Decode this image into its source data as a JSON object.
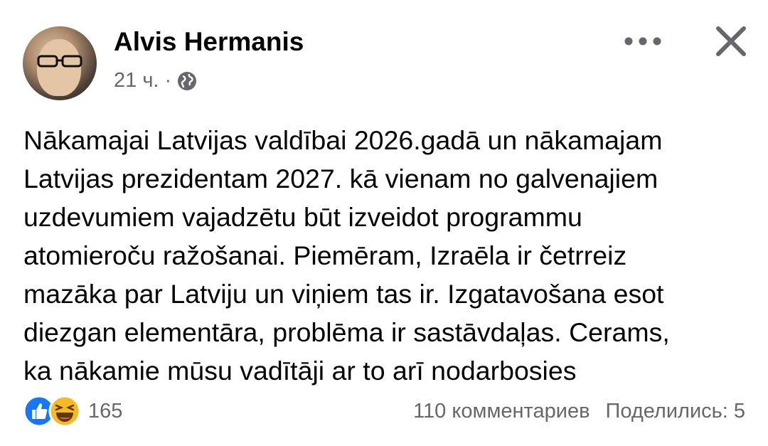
{
  "post": {
    "author": "Alvis Hermanis",
    "time": "21 ч.",
    "separator": "·",
    "visibility_icon": "globe-icon",
    "text_lines": [
      "Nākamajai Latvijas valdībai 2026.gadā un nākamajam",
      "Latvijas prezidentam 2027. kā vienam no galvenajiem",
      "uzdevumiem vajadzētu būt izveidot programmu",
      "atomieroču ražošanai. Piemēram, Izraēla ir četrreiz",
      "mazāka par Latviju un viņiem tas ir. Izgatavošana esot",
      "diezgan elementāra, problēma ir sastāvdaļas. Cerams,",
      "ka nākamie mūsu vadītāji ar to arī nodarbosies"
    ]
  },
  "header_actions": {
    "more_icon": "more-horizontal-icon",
    "close_icon": "close-icon"
  },
  "footer": {
    "reaction_icons": [
      "like-icon",
      "haha-icon"
    ],
    "reaction_count": "165",
    "comments": "110 комментариев",
    "shares": "Поделились: 5"
  },
  "colors": {
    "text": "#050505",
    "secondary": "#65676b",
    "like_blue": "#1877f2",
    "haha_yellow": "#f7b928"
  }
}
